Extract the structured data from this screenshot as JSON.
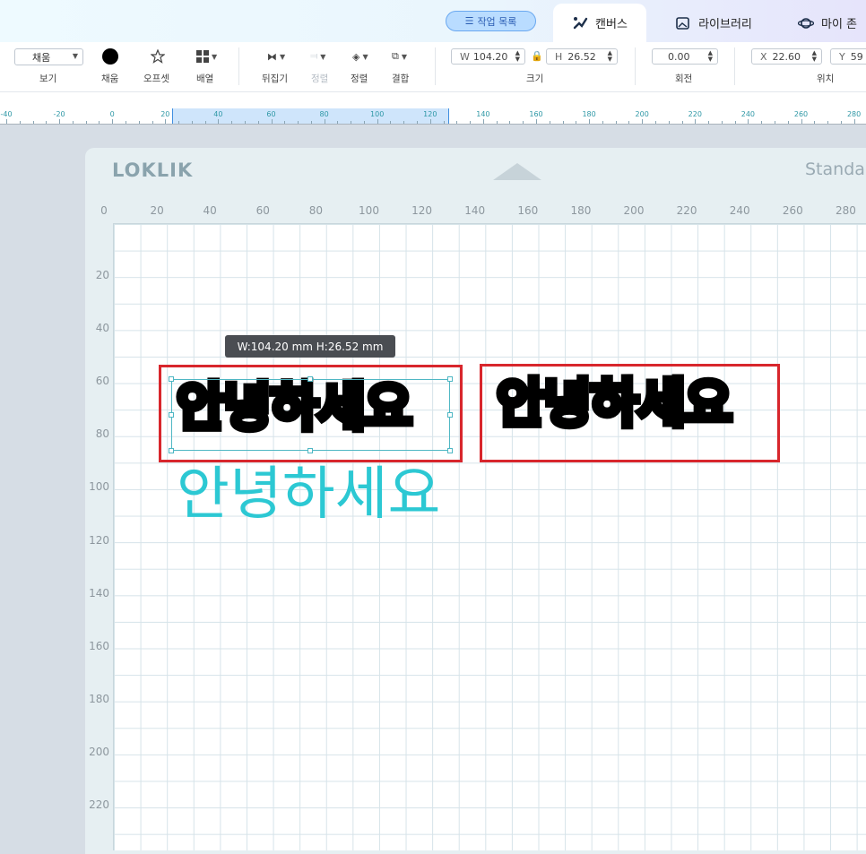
{
  "nav": {
    "worklist_label": "작업 목록",
    "tabs": [
      {
        "label": "캔버스",
        "icon": "canvas-brush-icon",
        "active": true
      },
      {
        "label": "라이브러리",
        "icon": "library-image-icon",
        "active": false
      },
      {
        "label": "마이 존",
        "icon": "my-zone-planet-icon",
        "active": false
      }
    ]
  },
  "toolbar": {
    "view_select_value": "채움",
    "view_label": "보기",
    "fill_label": "채움",
    "offset_label": "오프셋",
    "arrange_label": "배열",
    "flip_label": "뒤집기",
    "align_label": "정렬",
    "order_label": "정렬",
    "combine_label": "결합",
    "size": {
      "w_prefix": "W",
      "w_value": "104.20",
      "h_prefix": "H",
      "h_value": "26.52",
      "label": "크기"
    },
    "rotate": {
      "value": "0.00",
      "label": "회전"
    },
    "position": {
      "x_prefix": "X",
      "x_value": "22.60",
      "y_prefix": "Y",
      "y_value": "59",
      "label": "위치"
    },
    "fill_color": "#000000"
  },
  "ruler": {
    "numbers": [
      "-40",
      "-20",
      "0",
      "20",
      "40",
      "60",
      "80",
      "100",
      "120",
      "140",
      "160",
      "180",
      "200",
      "220",
      "240",
      "260",
      "280"
    ]
  },
  "mat": {
    "brand": "LOKLIK",
    "size_label": "Standa",
    "x_numbers": [
      "0",
      "20",
      "40",
      "60",
      "80",
      "100",
      "120",
      "140",
      "160",
      "180",
      "200",
      "220",
      "240",
      "260",
      "280"
    ],
    "y_numbers": [
      "20",
      "40",
      "60",
      "80",
      "100",
      "120",
      "140",
      "160",
      "180",
      "200",
      "220"
    ]
  },
  "canvas": {
    "tooltip": "W:104.20 mm  H:26.52 mm",
    "text_bold_1": "안녕하세요",
    "text_bold_2": "안녕하세요",
    "text_cyan": "안녕하세요",
    "colors": {
      "highlight_box": "#d8262c",
      "selection": "#4fb7c4",
      "cyan_text": "#2cc8d3"
    }
  }
}
